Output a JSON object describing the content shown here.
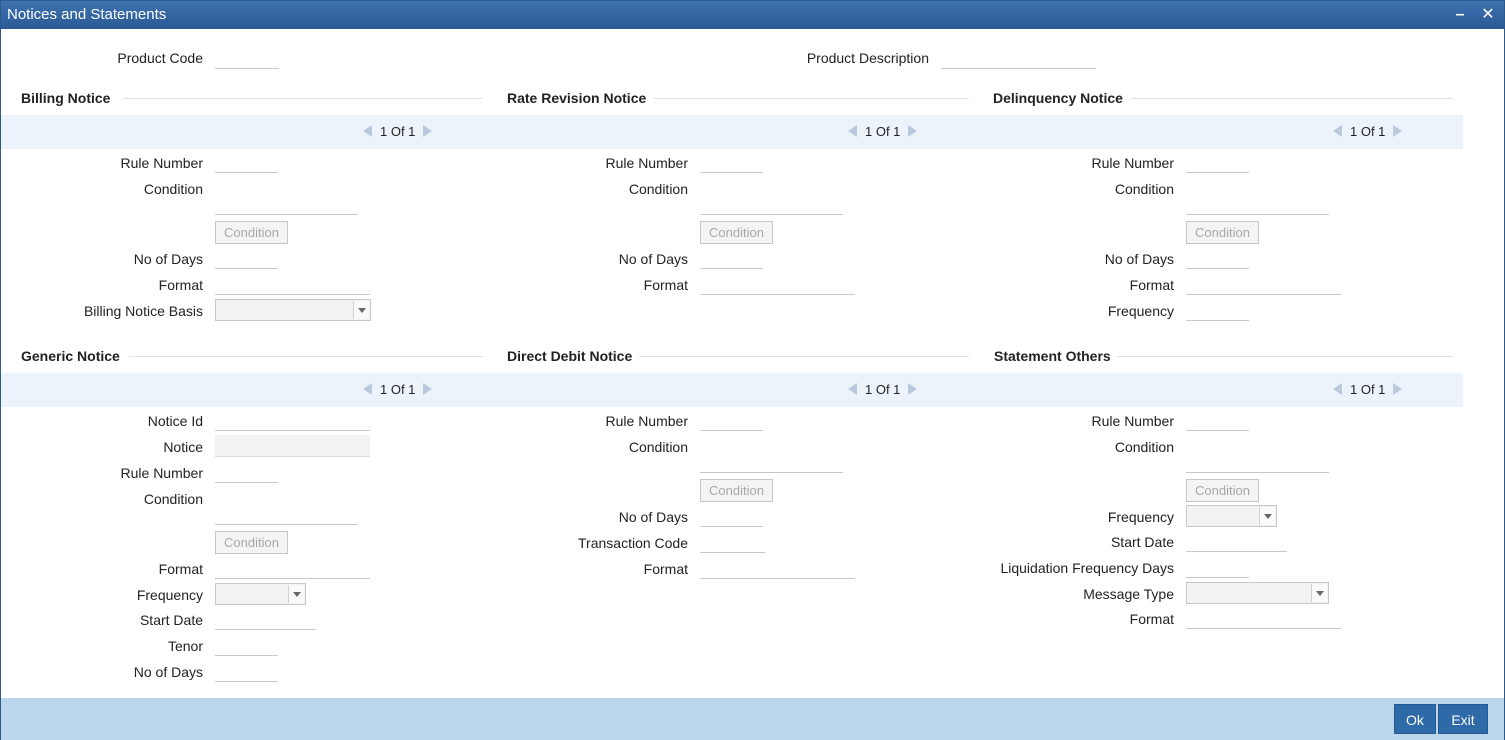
{
  "window": {
    "title": "Notices and Statements",
    "minimize_icon": "minimize-icon",
    "close_icon": "close-icon"
  },
  "header": {
    "product_code_label": "Product Code",
    "product_code_value": "",
    "product_description_label": "Product Description",
    "product_description_value": ""
  },
  "billing": {
    "title": "Billing Notice",
    "pager": "1 Of 1",
    "rule_number_label": "Rule Number",
    "condition_label": "Condition",
    "condition_button": "Condition",
    "no_of_days_label": "No of Days",
    "format_label": "Format",
    "basis_label": "Billing Notice Basis",
    "basis_value": ""
  },
  "rate_revision": {
    "title": "Rate Revision Notice",
    "pager": "1 Of 1",
    "rule_number_label": "Rule Number",
    "condition_label": "Condition",
    "condition_button": "Condition",
    "no_of_days_label": "No of Days",
    "format_label": "Format"
  },
  "delinquency": {
    "title": "Delinquency Notice",
    "pager": "1 Of 1",
    "rule_number_label": "Rule Number",
    "condition_label": "Condition",
    "condition_button": "Condition",
    "no_of_days_label": "No of Days",
    "format_label": "Format",
    "frequency_label": "Frequency"
  },
  "generic": {
    "title": "Generic Notice",
    "pager": "1 Of 1",
    "notice_id_label": "Notice Id",
    "notice_label": "Notice",
    "rule_number_label": "Rule Number",
    "condition_label": "Condition",
    "condition_button": "Condition",
    "format_label": "Format",
    "frequency_label": "Frequency",
    "frequency_value": "",
    "start_date_label": "Start Date",
    "tenor_label": "Tenor",
    "no_of_days_label": "No of Days"
  },
  "direct_debit": {
    "title": "Direct Debit Notice",
    "pager": "1 Of 1",
    "rule_number_label": "Rule Number",
    "condition_label": "Condition",
    "condition_button": "Condition",
    "no_of_days_label": "No of Days",
    "transaction_code_label": "Transaction Code",
    "format_label": "Format"
  },
  "statement_others": {
    "title": "Statement Others",
    "pager": "1 Of 1",
    "rule_number_label": "Rule Number",
    "condition_label": "Condition",
    "condition_button": "Condition",
    "frequency_label": "Frequency",
    "frequency_value": "",
    "start_date_label": "Start Date",
    "liquidation_label": "Liquidation Frequency Days",
    "message_type_label": "Message Type",
    "message_type_value": "",
    "format_label": "Format"
  },
  "footer": {
    "ok_label": "Ok",
    "exit_label": "Exit"
  }
}
